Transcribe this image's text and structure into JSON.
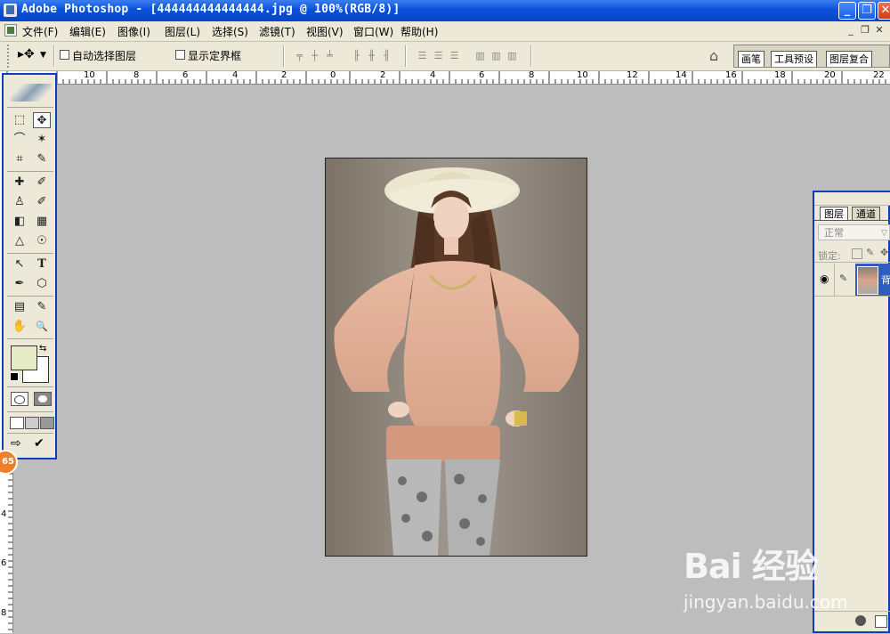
{
  "window": {
    "title": "Adobe Photoshop - [444444444444444.jpg @ 100%(RGB/8)]",
    "buttons": {
      "minimize": "_",
      "restore": "❐",
      "close": "✕"
    }
  },
  "menubar": {
    "items": [
      "文件(F)",
      "编辑(E)",
      "图像(I)",
      "图层(L)",
      "选择(S)",
      "滤镜(T)",
      "视图(V)",
      "窗口(W)",
      "帮助(H)"
    ],
    "doc_buttons": [
      "_",
      "❐",
      "✕"
    ]
  },
  "options_bar": {
    "tool_symbol": "▸✥",
    "auto_select_label": "自动选择图层",
    "show_bounds_label": "显示定界框",
    "palette_well_tabs": [
      "画笔",
      "工具预设",
      "图层复合"
    ]
  },
  "rulers": {
    "h_labels": [
      "10",
      "8",
      "6",
      "4",
      "2",
      "0",
      "2",
      "4",
      "6",
      "8",
      "10",
      "12",
      "14",
      "16",
      "18",
      "20",
      "22"
    ],
    "v_labels": [
      "4",
      "6",
      "8"
    ]
  },
  "toolbox": {
    "tools": [
      [
        "⬚",
        "✥"
      ],
      [
        "⌒",
        "✶"
      ],
      [
        "⌗",
        "✎"
      ],
      [
        "✚",
        "✐"
      ],
      [
        "♙",
        "✐"
      ],
      [
        "◧",
        "▦"
      ],
      [
        "△",
        "☉"
      ],
      [
        "↖",
        "T"
      ],
      [
        "✒",
        "⬡"
      ],
      [
        "▤",
        "✎"
      ],
      [
        "✋",
        "🔍"
      ]
    ],
    "foreground_color": "#e6edc4",
    "background_color": "#ffffff"
  },
  "layers_panel": {
    "tabs": [
      "图层",
      "通道"
    ],
    "blend_mode": "正常",
    "lock_label": "锁定:",
    "layer_name": "背"
  },
  "badge": {
    "text": "65"
  },
  "watermark": {
    "logo": "Bai 经验",
    "url": "jingyan.baidu.com"
  },
  "colors": {
    "title_bar": "#0a52d8",
    "chrome": "#ece9d8",
    "workspace": "#bdbdbd",
    "panel_border": "#0c3fb8"
  }
}
